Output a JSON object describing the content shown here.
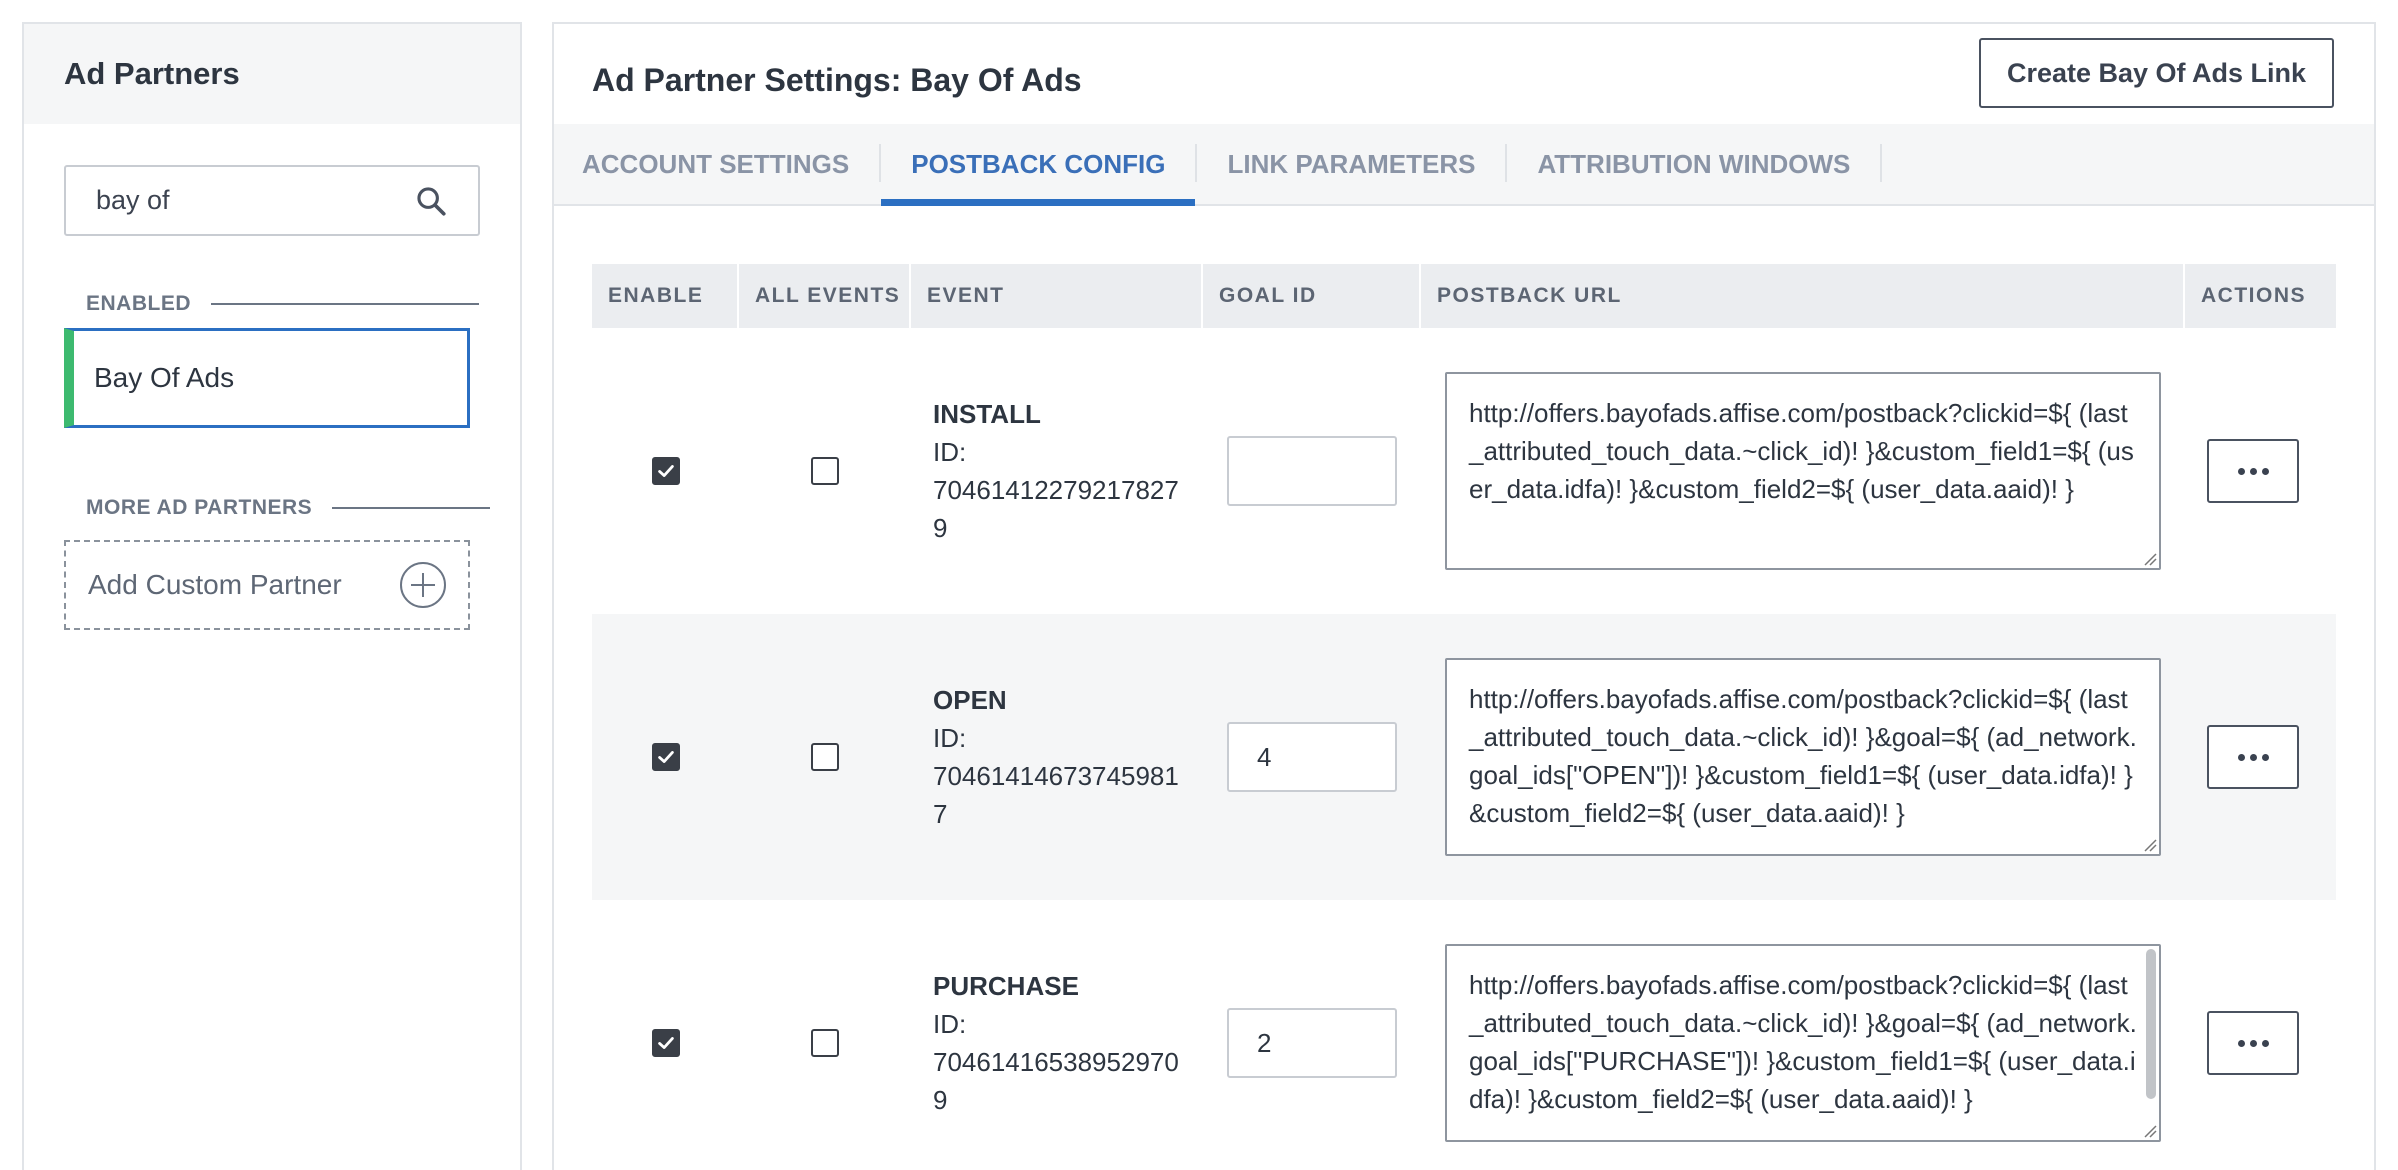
{
  "sidebar": {
    "title": "Ad Partners",
    "search": {
      "value": "bay of"
    },
    "enabled_label": "ENABLED",
    "enabled_items": [
      {
        "label": "Bay Of Ads"
      }
    ],
    "more_label": "MORE AD PARTNERS",
    "add_custom_label": "Add Custom Partner"
  },
  "main": {
    "title": "Ad Partner Settings: Bay Of Ads",
    "create_link_label": "Create Bay Of Ads Link",
    "tabs": [
      {
        "label": "ACCOUNT SETTINGS"
      },
      {
        "label": "POSTBACK CONFIG",
        "active": true
      },
      {
        "label": "LINK PARAMETERS"
      },
      {
        "label": "ATTRIBUTION WINDOWS"
      }
    ],
    "table": {
      "headers": [
        "ENABLE",
        "ALL EVENTS",
        "EVENT",
        "GOAL ID",
        "POSTBACK URL",
        "ACTIONS"
      ],
      "rows": [
        {
          "enabled": true,
          "all_events": false,
          "event": "INSTALL",
          "id_label": "ID:",
          "id_line1": "70461412279217827",
          "id_line2": "9",
          "goal_id": "",
          "postback_url": "http://offers.bayofads.affise.com/postback?clickid=${ (last_attributed_touch_data.~click_id)! }&custom_field1=${ (user_data.idfa)! }&custom_field2=${ (user_data.aaid)! }"
        },
        {
          "enabled": true,
          "all_events": false,
          "event": "OPEN",
          "id_label": "ID:",
          "id_line1": "70461414673745981",
          "id_line2": "7",
          "goal_id": "4",
          "postback_url": "http://offers.bayofads.affise.com/postback?clickid=${ (last_attributed_touch_data.~click_id)! }&goal=${ (ad_network.goal_ids[\"OPEN\"])! }&custom_field1=${ (user_data.idfa)! }&custom_field2=${ (user_data.aaid)! }"
        },
        {
          "enabled": true,
          "all_events": false,
          "event": "PURCHASE",
          "id_label": "ID:",
          "id_line1": "70461416538952970",
          "id_line2": "9",
          "goal_id": "2",
          "postback_url": "http://offers.bayofads.affise.com/postback?clickid=${ (last_attributed_touch_data.~click_id)! }&goal=${ (ad_network.goal_ids[\"PURCHASE\"])! }&custom_field1=${ (user_data.idfa)! }&custom_field2=${ (user_data.aaid)! }"
        }
      ]
    }
  },
  "colors": {
    "accent": "#2b6fc2",
    "enabled_marker": "#3dba6f"
  },
  "icons": {
    "search": "search-icon",
    "add": "plus-circle-icon",
    "more": "more-dots-icon",
    "check": "checkmark-icon"
  }
}
